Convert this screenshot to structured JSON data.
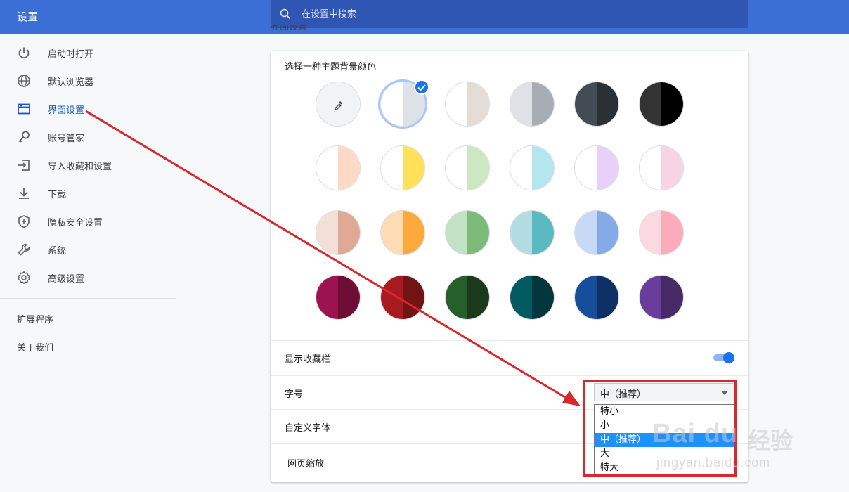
{
  "header": {
    "title": "设置",
    "search_placeholder": "在设置中搜索"
  },
  "sidebar": {
    "items": [
      {
        "label": "启动时打开",
        "icon": "power-icon"
      },
      {
        "label": "默认浏览器",
        "icon": "globe-icon"
      },
      {
        "label": "界面设置",
        "icon": "browser-window-icon",
        "active": true
      },
      {
        "label": "账号管家",
        "icon": "key-icon"
      },
      {
        "label": "导入收藏和设置",
        "icon": "import-icon"
      },
      {
        "label": "下载",
        "icon": "download-icon"
      },
      {
        "label": "隐私安全设置",
        "icon": "shield-icon"
      },
      {
        "label": "系统",
        "icon": "wrench-icon"
      },
      {
        "label": "高级设置",
        "icon": "gear-icon"
      }
    ],
    "links": [
      "扩展程序",
      "关于我们"
    ]
  },
  "main": {
    "section_title": "界面设置",
    "theme_label": "选择一种主题背景颜色",
    "themes": [
      {
        "left": "#f1f3f4",
        "right": "#f1f3f4",
        "kind": "custom"
      },
      {
        "left": "#ffffff",
        "right": "#dee1e6",
        "selected": true
      },
      {
        "left": "#ffffff",
        "right": "#e3dcd7"
      },
      {
        "left": "#dee1e6",
        "right": "#a8acb5"
      },
      {
        "left": "#434c55",
        "right": "#2b3035"
      },
      {
        "left": "#333333",
        "right": "#000000"
      },
      {
        "left": "#ffffff",
        "right": "#fddac7"
      },
      {
        "left": "#ffffff",
        "right": "#ffe05a"
      },
      {
        "left": "#ffffff",
        "right": "#cbe8c3"
      },
      {
        "left": "#ffffff",
        "right": "#b4e6f0"
      },
      {
        "left": "#ffffff",
        "right": "#e8d1f8"
      },
      {
        "left": "#ffffff",
        "right": "#f8d4e2"
      },
      {
        "left": "#f4dfd6",
        "right": "#e0a995"
      },
      {
        "left": "#fddcb5",
        "right": "#fca93e"
      },
      {
        "left": "#c3e1c4",
        "right": "#7dbc78"
      },
      {
        "left": "#b2dce2",
        "right": "#5bb9c1"
      },
      {
        "left": "#c7d9f7",
        "right": "#86aae8"
      },
      {
        "left": "#fcd9e0",
        "right": "#fbabbc"
      },
      {
        "left": "#9b1450",
        "right": "#6e0d36"
      },
      {
        "left": "#a81a1f",
        "right": "#721314"
      },
      {
        "left": "#275f2b",
        "right": "#1b3a1c"
      },
      {
        "left": "#045a63",
        "right": "#03373d"
      },
      {
        "left": "#164e9c",
        "right": "#0f3065"
      },
      {
        "left": "#6a3d9c",
        "right": "#472a66"
      }
    ],
    "show_bookmarks_label": "显示收藏栏",
    "show_bookmarks_on": true,
    "font_size_label": "字号",
    "font_size_value": "中（推荐）",
    "font_size_options": [
      "特小",
      "小",
      "中（推荐）",
      "大",
      "特大"
    ],
    "font_size_selected_index": 2,
    "custom_font_label": "自定义字体",
    "page_zoom_label": "网页缩放"
  },
  "colors": {
    "header_bg": "#3b6fd6",
    "search_bg": "#2f56b2",
    "accent": "#1a73e8",
    "annotation_red": "#d9272e"
  },
  "watermark": {
    "logo": "Bai du",
    "text_cn": "经验",
    "url": "jingyan.baidu.com"
  }
}
